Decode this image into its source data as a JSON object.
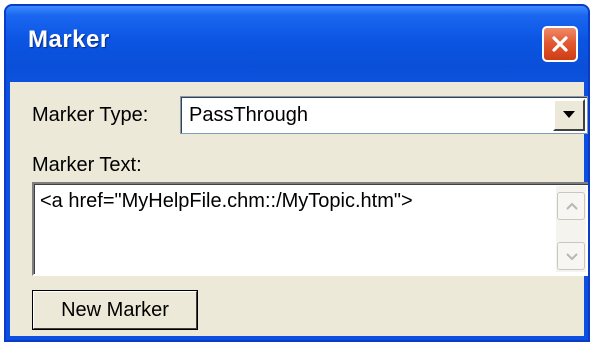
{
  "window": {
    "title": "Marker"
  },
  "form": {
    "marker_type_label": "Marker Type:",
    "marker_type_value": "PassThrough",
    "marker_text_label": "Marker Text:",
    "marker_text_value": "<a href=\"MyHelpFile.chm::/MyTopic.htm\">",
    "new_marker_label": "New Marker"
  },
  "icons": {
    "close": "close-icon",
    "dropdown": "chevron-down-icon",
    "scroll_up": "chevron-up-icon",
    "scroll_down": "chevron-down-icon"
  },
  "colors": {
    "titlebar": "#0b55e3",
    "close_button": "#e25a34",
    "dialog_background": "#ece9d8"
  }
}
